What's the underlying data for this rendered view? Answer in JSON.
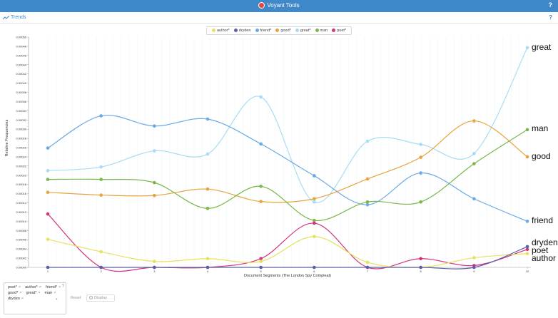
{
  "app": {
    "title": "Voyant Tools",
    "help": "?"
  },
  "panel": {
    "title": "Trends",
    "help": "?"
  },
  "legend": [
    {
      "label": "author*",
      "color": "#e6e25e"
    },
    {
      "label": "dryden",
      "color": "#5a5fa8"
    },
    {
      "label": "friend*",
      "color": "#6aa9e6"
    },
    {
      "label": "good*",
      "color": "#e8a33c"
    },
    {
      "label": "great*",
      "color": "#a9dcf2"
    },
    {
      "label": "man",
      "color": "#79b74a"
    },
    {
      "label": "poet*",
      "color": "#d4337c"
    }
  ],
  "chart_data": {
    "type": "line",
    "ylabel": "Relative Frequencies",
    "xlabel": "Document Segments (The London Spy Compleat)",
    "x": [
      1,
      2,
      3,
      4,
      5,
      6,
      7,
      8,
      9,
      10
    ],
    "ylim": [
      0,
      0.0005
    ],
    "yticks": [
      "0.00000",
      "0.00002",
      "0.00004",
      "0.00006",
      "0.00008",
      "0.00010",
      "0.00012",
      "0.00014",
      "0.00016",
      "0.00018",
      "0.00020",
      "0.00022",
      "0.00024",
      "0.00026",
      "0.00028",
      "0.00030",
      "0.00032",
      "0.00034",
      "0.00036",
      "0.00038",
      "0.00040",
      "0.00042",
      "0.00044",
      "0.00046",
      "0.00048",
      "0.00050"
    ],
    "series": [
      {
        "name": "great",
        "color": "#a9dcf2",
        "values": [
          0.00021,
          0.000218,
          0.000253,
          0.000246,
          0.00037,
          0.000142,
          0.000274,
          0.000267,
          0.000247,
          0.000477
        ]
      },
      {
        "name": "friend",
        "color": "#6aa9e6",
        "values": [
          0.000259,
          0.000329,
          0.000307,
          0.000322,
          0.000268,
          0.000199,
          0.000136,
          0.000205,
          0.000149,
          0.0001
        ]
      },
      {
        "name": "good",
        "color": "#e8a33c",
        "values": [
          0.000163,
          0.000157,
          0.000156,
          0.00017,
          0.000143,
          0.000149,
          0.000192,
          0.000239,
          0.000318,
          0.00024
        ]
      },
      {
        "name": "man",
        "color": "#79b74a",
        "values": [
          0.000191,
          0.000191,
          0.000184,
          0.000128,
          0.000176,
          0.000102,
          0.000142,
          0.000142,
          0.000225,
          0.000299
        ]
      },
      {
        "name": "poet",
        "color": "#d4337c",
        "values": [
          0.000116,
          0.0,
          0.0,
          0.0,
          1.9e-05,
          9.6e-05,
          0.0,
          1.9e-05,
          4e-06,
          3.9e-05
        ]
      },
      {
        "name": "author",
        "color": "#e6e25e",
        "values": [
          6.1e-05,
          3.4e-05,
          1.3e-05,
          1.9e-05,
          1.3e-05,
          6.7e-05,
          1.1e-05,
          0.0,
          2.1e-05,
          3e-05
        ]
      },
      {
        "name": "dryden",
        "color": "#5a5fa8",
        "values": [
          0.0,
          0.0,
          0.0,
          0.0,
          0.0,
          0.0,
          0.0,
          0.0,
          0.0,
          4.5e-05
        ]
      }
    ],
    "end_labels": [
      "great",
      "man",
      "good",
      "friend",
      "dryden",
      "poet",
      "author"
    ]
  },
  "terms_box": {
    "tags": [
      "poet*",
      "author*",
      "friend*",
      "good*",
      "great*",
      "man",
      "dryden"
    ],
    "help": "?",
    "remove": "×"
  },
  "controls": {
    "reset_label": "Reset",
    "display_label": "Display"
  }
}
